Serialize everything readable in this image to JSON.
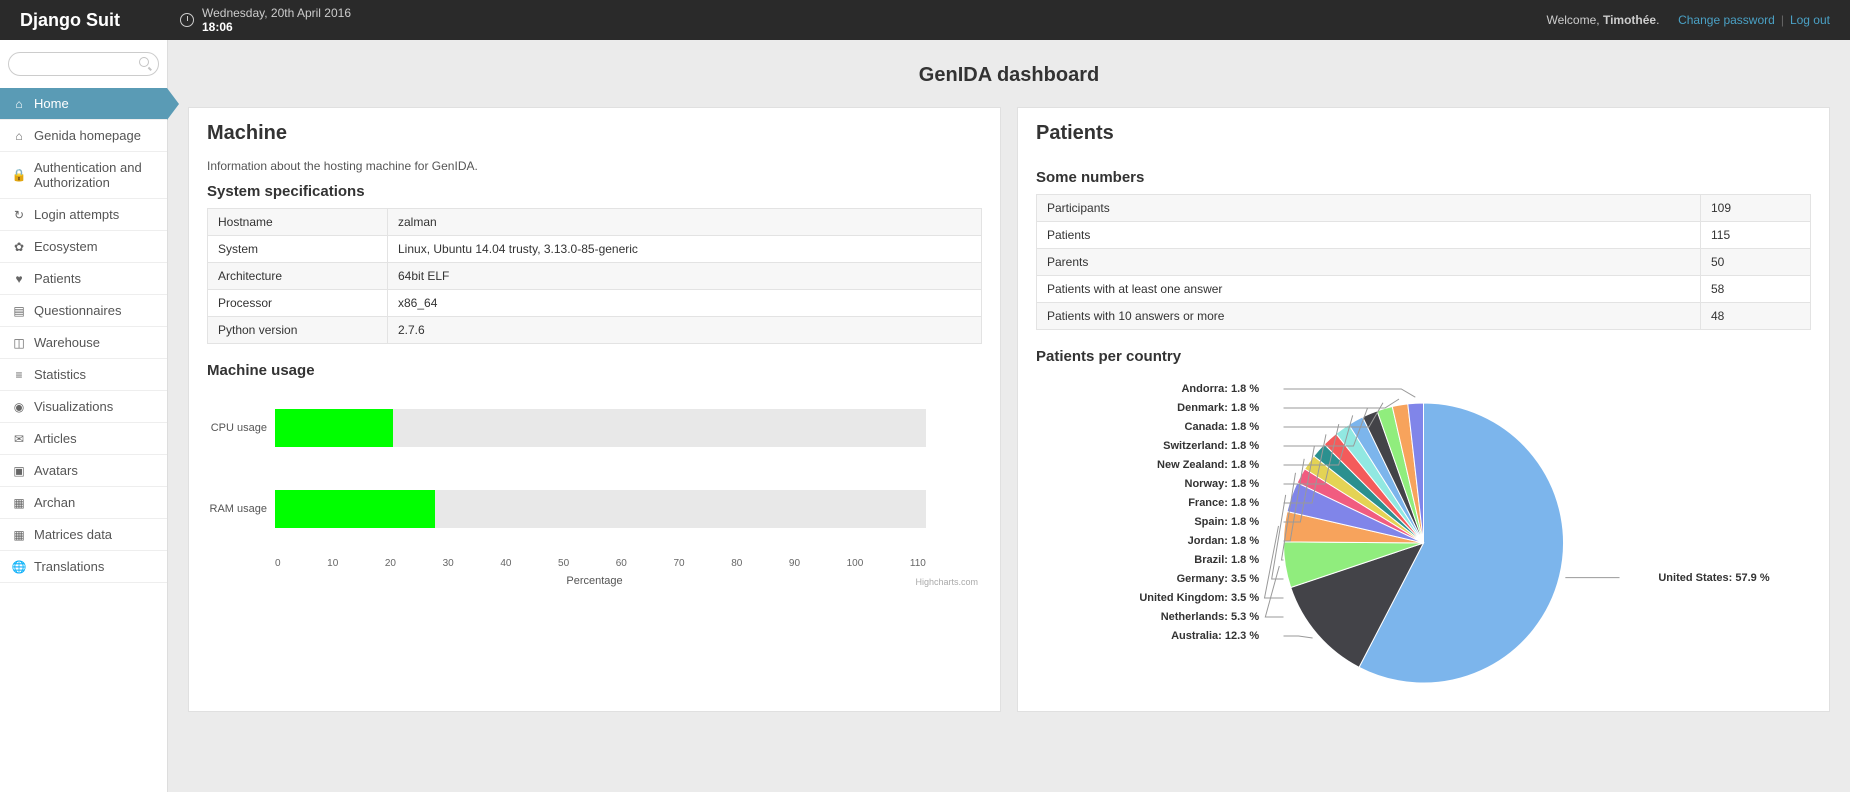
{
  "header": {
    "brand": "Django Suit",
    "date": "Wednesday, 20th April 2016",
    "time": "18:06",
    "welcome_prefix": "Welcome, ",
    "username": "Timothée",
    "change_password": "Change password",
    "logout": "Log out"
  },
  "search": {
    "placeholder": ""
  },
  "nav": [
    {
      "label": "Home",
      "icon": "home-icon",
      "active": true
    },
    {
      "label": "Genida homepage",
      "icon": "home-icon"
    },
    {
      "label": "Authentication and Authorization",
      "icon": "lock-icon"
    },
    {
      "label": "Login attempts",
      "icon": "refresh-icon"
    },
    {
      "label": "Ecosystem",
      "icon": "leaf-icon"
    },
    {
      "label": "Patients",
      "icon": "heart-icon"
    },
    {
      "label": "Questionnaires",
      "icon": "list-icon"
    },
    {
      "label": "Warehouse",
      "icon": "box-icon"
    },
    {
      "label": "Statistics",
      "icon": "bars-icon"
    },
    {
      "label": "Visualizations",
      "icon": "eye-icon"
    },
    {
      "label": "Articles",
      "icon": "comment-icon"
    },
    {
      "label": "Avatars",
      "icon": "image-icon"
    },
    {
      "label": "Archan",
      "icon": "grid-icon"
    },
    {
      "label": "Matrices data",
      "icon": "grid-icon"
    },
    {
      "label": "Translations",
      "icon": "globe-icon"
    }
  ],
  "page": {
    "title": "GenIDA dashboard"
  },
  "machine": {
    "heading": "Machine",
    "description": "Information about the hosting machine for GenIDA.",
    "specs_heading": "System specifications",
    "specs": [
      {
        "k": "Hostname",
        "v": "zalman"
      },
      {
        "k": "System",
        "v": "Linux, Ubuntu 14.04 trusty, 3.13.0-85-generic"
      },
      {
        "k": "Architecture",
        "v": "64bit ELF"
      },
      {
        "k": "Processor",
        "v": "x86_64"
      },
      {
        "k": "Python version",
        "v": "2.7.6"
      }
    ],
    "usage_heading": "Machine usage",
    "chart_credit": "Highcharts.com"
  },
  "patients": {
    "heading": "Patients",
    "numbers_heading": "Some numbers",
    "numbers": [
      {
        "k": "Participants",
        "v": "109"
      },
      {
        "k": "Patients",
        "v": "115"
      },
      {
        "k": "Parents",
        "v": "50"
      },
      {
        "k": "Patients with at least one answer",
        "v": "58"
      },
      {
        "k": "Patients with 10 answers or more",
        "v": "48"
      }
    ],
    "per_country_heading": "Patients per country"
  },
  "chart_data": [
    {
      "type": "bar",
      "title": "Machine usage",
      "categories": [
        "CPU usage",
        "RAM usage"
      ],
      "values": [
        20,
        27
      ],
      "xlabel": "Percentage",
      "ylabel": "",
      "xlim": [
        0,
        110
      ],
      "ticks": [
        "0",
        "10",
        "20",
        "30",
        "40",
        "50",
        "60",
        "70",
        "80",
        "90",
        "100",
        "110"
      ]
    },
    {
      "type": "pie",
      "title": "Patients per country",
      "series": [
        {
          "name": "United States",
          "value": 57.9,
          "color": "#7cb5ec"
        },
        {
          "name": "Australia",
          "value": 12.3,
          "color": "#434348"
        },
        {
          "name": "Netherlands",
          "value": 5.3,
          "color": "#90ed7d"
        },
        {
          "name": "United Kingdom",
          "value": 3.5,
          "color": "#f7a35c"
        },
        {
          "name": "Germany",
          "value": 3.5,
          "color": "#8085e9"
        },
        {
          "name": "Brazil",
          "value": 1.8,
          "color": "#f15c80"
        },
        {
          "name": "Jordan",
          "value": 1.8,
          "color": "#e4d354"
        },
        {
          "name": "Spain",
          "value": 1.8,
          "color": "#2b908f"
        },
        {
          "name": "France",
          "value": 1.8,
          "color": "#f45b5b"
        },
        {
          "name": "Norway",
          "value": 1.8,
          "color": "#91e8e1"
        },
        {
          "name": "New Zealand",
          "value": 1.8,
          "color": "#7cb5ec"
        },
        {
          "name": "Switzerland",
          "value": 1.8,
          "color": "#434348"
        },
        {
          "name": "Canada",
          "value": 1.8,
          "color": "#90ed7d"
        },
        {
          "name": "Denmark",
          "value": 1.8,
          "color": "#f7a35c"
        },
        {
          "name": "Andorra",
          "value": 1.8,
          "color": "#8085e9"
        }
      ]
    }
  ]
}
